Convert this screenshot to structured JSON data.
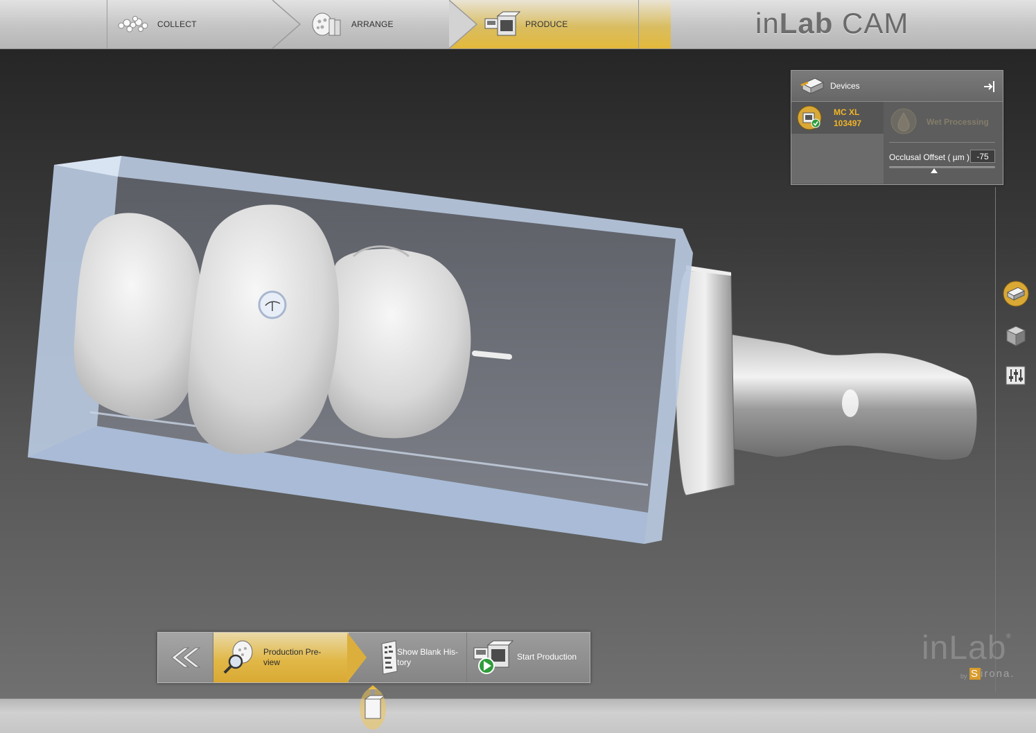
{
  "app": {
    "title_light": "in",
    "title_bold": "Lab",
    "title_suffix": " CAM"
  },
  "workflow_steps": [
    {
      "label": "COLLECT",
      "active": false
    },
    {
      "label": "ARRANGE",
      "active": false
    },
    {
      "label": "PRODUCE",
      "active": true
    }
  ],
  "devices_panel": {
    "title": "Devices",
    "device": {
      "name": "MC XL",
      "serial": "103497"
    },
    "wet_processing_label": "Wet Processing",
    "occlusal_offset_label": "Occlusal Offset ( µm )",
    "occlusal_offset_value": "-75"
  },
  "actions": {
    "production_preview": "Production Pre-\nview",
    "show_blank_history": "Show Blank His-\ntory",
    "start_production": "Start Production"
  },
  "logo": {
    "text": "inLab",
    "reg": "®",
    "by": "by",
    "company_first": "S",
    "company_rest": "irona."
  },
  "colors": {
    "accent": "#e3b93a",
    "device_text": "#f0b429"
  },
  "icons": [
    "collect-icon",
    "arrange-icon",
    "produce-icon",
    "devices-icon",
    "panel-pin-icon",
    "mill-device-icon",
    "wet-processing-icon",
    "side-devices-icon",
    "side-blank-icon",
    "side-parameters-icon",
    "back-chevrons-icon",
    "production-preview-icon",
    "blank-history-icon",
    "start-production-icon",
    "blank-marker-icon"
  ]
}
